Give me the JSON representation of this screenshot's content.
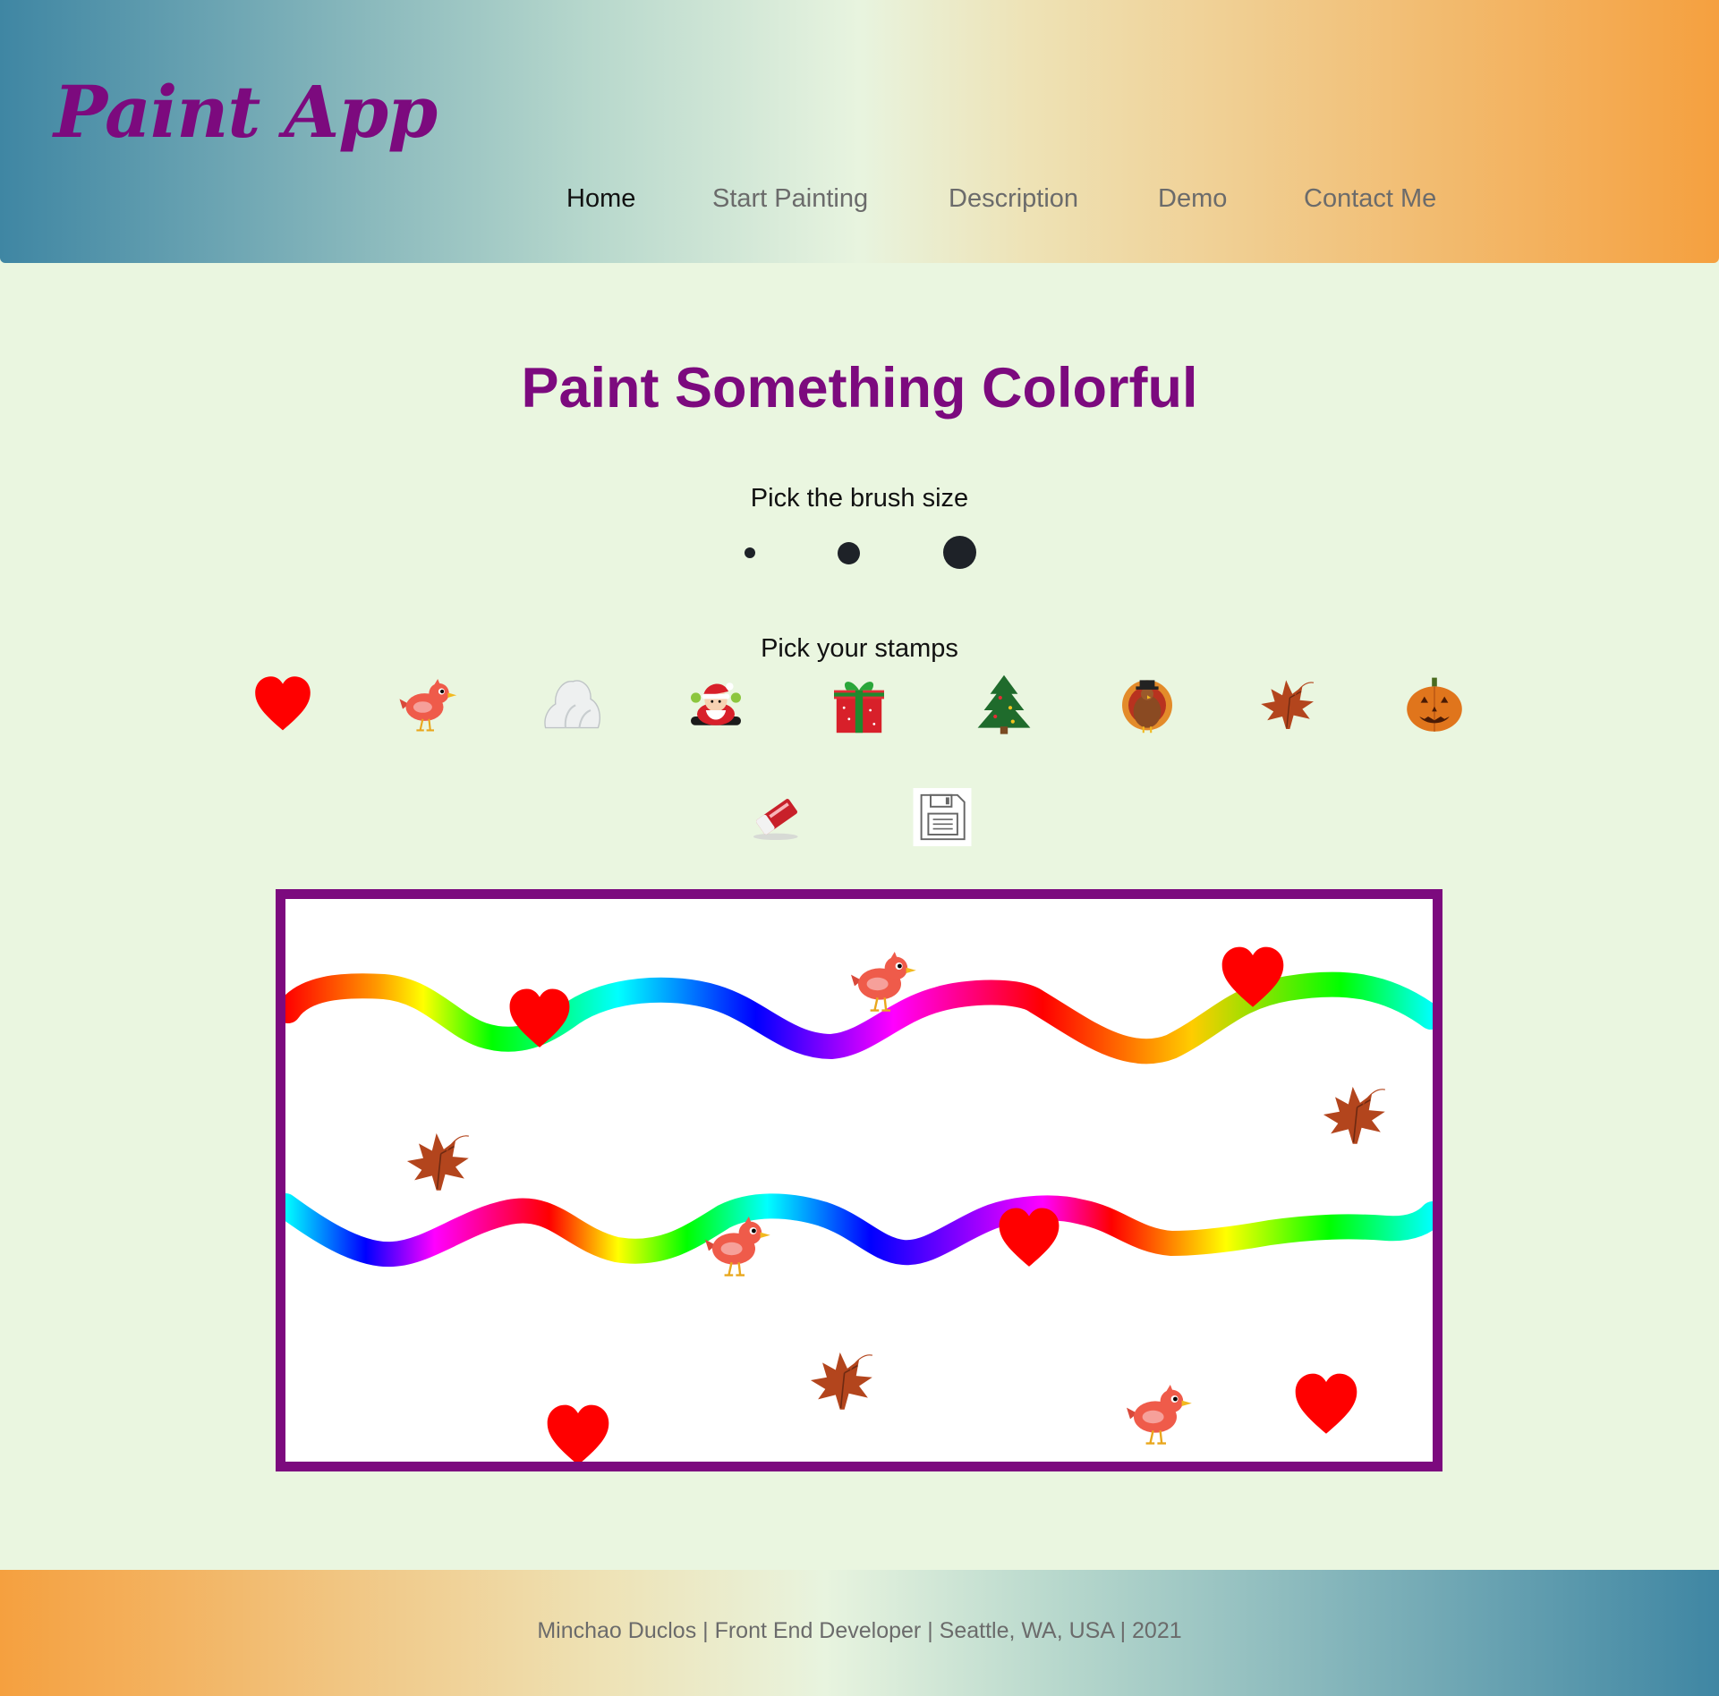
{
  "app": {
    "title": "Paint App"
  },
  "nav": {
    "items": [
      {
        "label": "Home",
        "active": true
      },
      {
        "label": "Start Painting",
        "active": false
      },
      {
        "label": "Description",
        "active": false
      },
      {
        "label": "Demo",
        "active": false
      },
      {
        "label": "Contact Me",
        "active": false
      }
    ]
  },
  "main": {
    "title": "Paint Something Colorful",
    "brush_label": "Pick the brush size",
    "brush_sizes": [
      "small",
      "medium",
      "large"
    ],
    "stamps_label": "Pick your stamps",
    "stamps": [
      "heart-icon",
      "bird-icon",
      "snow-rock-icon",
      "santa-icon",
      "gift-icon",
      "christmas-tree-icon",
      "turkey-icon",
      "maple-leaf-icon",
      "jack-o-lantern-icon"
    ],
    "tools": [
      "eraser-icon",
      "save-icon"
    ]
  },
  "canvas": {
    "border_color": "#7c0a7e",
    "stroke_style": "rainbow",
    "placed_stamps": [
      "heart",
      "bird",
      "heart",
      "maple-leaf",
      "maple-leaf",
      "bird",
      "heart",
      "heart",
      "maple-leaf",
      "bird",
      "heart"
    ]
  },
  "footer": {
    "text": "Minchao Duclos | Front End Developer | Seattle, WA, USA | 2021"
  },
  "colors": {
    "accent": "#7c0a7e",
    "background": "#eaf6e0",
    "gradient_start": "#3f86a3",
    "gradient_end": "#f5a03f"
  }
}
